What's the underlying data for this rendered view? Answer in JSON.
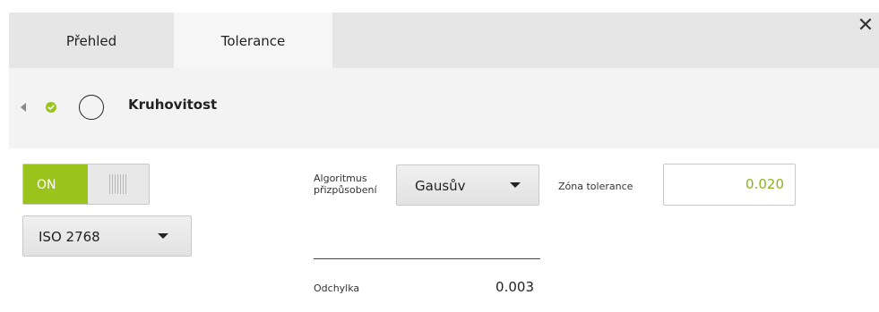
{
  "tabs": [
    {
      "label": "Přehled"
    },
    {
      "label": "Tolerance",
      "active": true
    }
  ],
  "close_icon": "close-icon",
  "header": {
    "back_icon": "chevron-left-icon",
    "status_icon": "check-circle-icon",
    "feature_icon": "circle-icon",
    "title": "Kruhovitost"
  },
  "toggle": {
    "label": "ON",
    "state": "on"
  },
  "standard_select": {
    "value": "ISO 2768"
  },
  "fit_algorithm": {
    "label": "Algoritmus přizpůsobení",
    "value": "Gausův"
  },
  "tolerance_zone": {
    "label": "Zóna tolerance",
    "value": "0.020"
  },
  "deviation": {
    "label": "Odchylka",
    "value": "0.003"
  },
  "colors": {
    "accent": "#9ac31c",
    "value_green": "#8ab31a",
    "tab_bar": "#e6e6e6",
    "active_tab": "#f6f6f6",
    "header_bg": "#f3f3f3"
  }
}
